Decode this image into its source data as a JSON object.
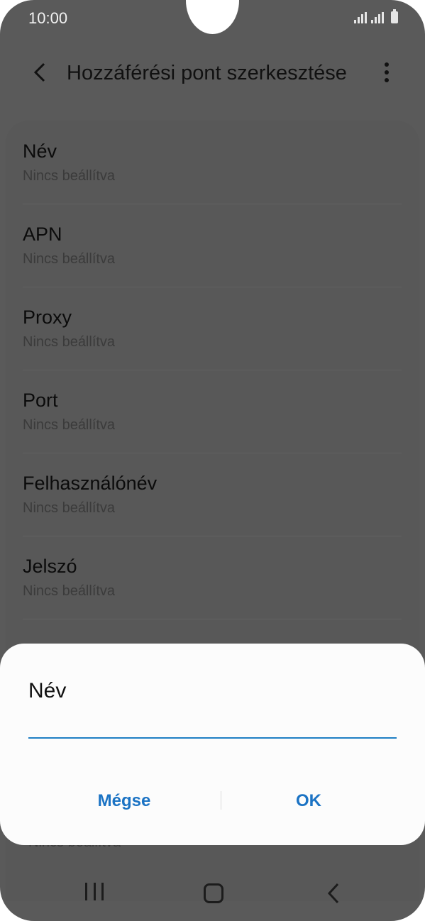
{
  "status_bar": {
    "time": "10:00",
    "icons": [
      "signal-icon",
      "signal-icon",
      "battery-icon"
    ]
  },
  "app_bar": {
    "title": "Hozzáférési pont szerkesztése",
    "back_icon": "back-arrow-icon",
    "menu_icon": "more-vert-icon"
  },
  "settings": [
    {
      "label": "Név",
      "value": "Nincs beállítva"
    },
    {
      "label": "APN",
      "value": "Nincs beállítva"
    },
    {
      "label": "Proxy",
      "value": "Nincs beállítva"
    },
    {
      "label": "Port",
      "value": "Nincs beállítva"
    },
    {
      "label": "Felhasználónév",
      "value": "Nincs beállítva"
    },
    {
      "label": "Jelszó",
      "value": "Nincs beállítva"
    }
  ],
  "partially_hidden_value": "Nincs beállítva",
  "dialog": {
    "title": "Név",
    "input_value": "",
    "cancel_label": "Mégse",
    "ok_label": "OK"
  },
  "nav_bar": {
    "icons": [
      "recent-apps-icon",
      "home-icon",
      "back-icon"
    ]
  },
  "colors": {
    "accent": "#1b73c4",
    "scrim": "#5a5a5a",
    "dialog_bg": "#fcfcfc"
  }
}
